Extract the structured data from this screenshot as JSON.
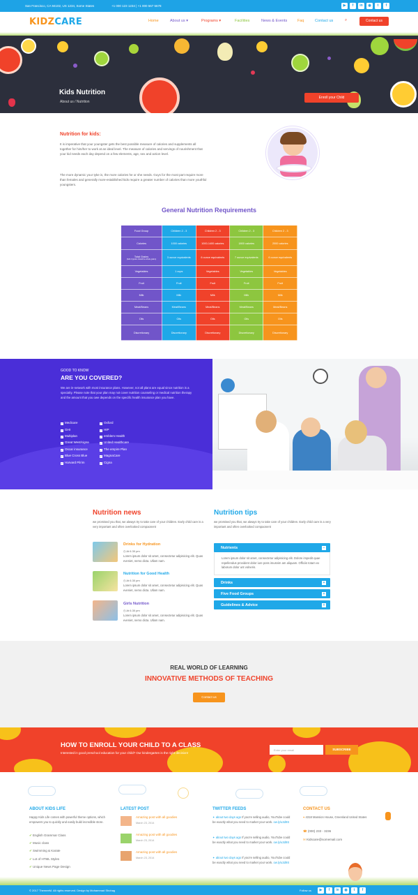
{
  "topbar": {
    "address": "San Francisco, CA 94102, US 1234, Some States",
    "phones": "+1 000 123 1234 | +1 000 567 5678",
    "social": [
      "▶",
      "f",
      "in",
      "◉",
      "t",
      "f"
    ]
  },
  "brand": {
    "logo_part1": "KIDZ",
    "logo_part2": "CARE",
    "colors": {
      "accent_blue": "#1ea3e6",
      "accent_red": "#f0422a",
      "purple": "#7155c9",
      "green": "#8dc63f",
      "orange": "#f7941d"
    }
  },
  "nav": {
    "items": [
      "Home",
      "About us",
      "Programs",
      "Facilities",
      "News & Events",
      "Faq",
      "Contact us"
    ],
    "contact_button": "Contact us",
    "search_icon": "search-icon"
  },
  "hero": {
    "title": "Kids Nutrition",
    "breadcrumb": "About us / Nutrition",
    "enroll_button": "Enroll your Child"
  },
  "about": {
    "heading": "Nutrition for kids:",
    "para1": "It is imperative that your youngster gets the best possible measure of calories and supplements all together for him/her to work at an ideal level. The measure of calories and servings of nourishment that your kid needs each day depend on a few elements, age, sex and action level.",
    "para2": "The more dynamic your tyke is, the more calories he or she needs. Guys for the most part require more than females and generally more-established kids require a greater number of calories than more youthful youngsters."
  },
  "table": {
    "title": "General Nutrition Requirements",
    "header": [
      "Food Group",
      "Children 2 - 3",
      "Children 2 - 3",
      "Children 2 - 3",
      "Children 2 - 3"
    ],
    "rows": [
      [
        "Calories",
        "1000 calories",
        "1000-1400 calories",
        "1800 calories",
        "2000 calories"
      ],
      [
        "Total Grains",
        "3 ounce equivalents",
        "6 ounce equivalents",
        "7 ounce equivalents",
        "6 ounce equivalents"
      ],
      [
        "Vegetables",
        "1 cups",
        "Vegetables",
        "Vegetables",
        "Vegetables"
      ],
      [
        "Fruit",
        "Fruit",
        "Fruit",
        "Fruit",
        "Fruit"
      ],
      [
        "Milk",
        "Milk",
        "Milk",
        "Milk",
        "Milk"
      ],
      [
        "Meat/Beans",
        "Meat/Beans",
        "Meat/Beans",
        "Meat/Beans",
        "Meat/Beans"
      ],
      [
        "Oils",
        "Oils",
        "Oils",
        "Oils",
        "Oils"
      ],
      [
        "Discretionary",
        "Discretionary",
        "Discretionary",
        "Discretionary",
        "Discretionary"
      ]
    ],
    "grains_note": "(half of grains should be whole grains)"
  },
  "covered": {
    "kicker": "GOOD TO KNOW",
    "heading": "ARE YOU COVERED?",
    "text": "We are in-network with most insurance plans. However, not all plans are equal since nutrition is a specialty. Please note that your plan may not cover nutrition counseling or medical nutrition therapy and the amount that you owe depends on the specific health insurance plan you have.",
    "col1": [
      "Medicare",
      "GHI",
      "Multiplan",
      "Great West/cigna",
      "Oscar insurance",
      "Blue Cross Blue",
      "Harvard Pilrim"
    ],
    "col2": [
      "Oxford",
      "HIP",
      "emblem Health",
      "United Healthcare",
      "The empire Plan",
      "MagnaCare",
      "Cigna"
    ]
  },
  "news": {
    "title": "Nutrition news",
    "intro": "we promised you that, we always try to take care of your children. Early child care is a very important and often overlooked compaonent",
    "items": [
      {
        "title": "Drinks for Hydration",
        "time": "At 6.30 pm",
        "text": "Lorem ipsum dolor sit amet, consectetur adipisicing elit. Quas eveniet, nemo dicta. Ullam nam."
      },
      {
        "title": "Nutrition for Good Health",
        "time": "At 6.30 pm",
        "text": "Lorem ipsum dolor sit amet, consectetur adipisicing elit. Quas eveniet, nemo dicta. Ullam nam."
      },
      {
        "title": "Girls Nutrition",
        "time": "At 6.30 pm",
        "text": "Lorem ipsum dolor sit amet, consectetur adipisicing elit. Quas eveniet, nemo dicta. Ullam nam."
      }
    ]
  },
  "tips": {
    "title": "Nutrition tips",
    "intro": "we promised you that, we always try to take care of your children. Early child care is a very important and often overlooked compaonent",
    "accordion": [
      {
        "label": "Nutrients",
        "body": "Lorem ipsum dolor sit amet, consectetur adipisicing elit. Dolore impedit quae repellendus provident dolor iure poss imusnim am aliquam. Officiis totam ex laborum dolor unt volneris.",
        "open": true
      },
      {
        "label": "Drinks"
      },
      {
        "label": "Five Food Groups"
      },
      {
        "label": "Guidelines & Advice"
      }
    ]
  },
  "learning": {
    "kicker": "REAL WORLD OF LEARNING",
    "heading": "INNOVATIVE METHODS OF TEACHING",
    "button": "Contact us"
  },
  "enroll": {
    "heading": "HOW TO ENROLL YOUR CHILD TO A CLASS",
    "sub": "Interested in good preschool education for your child? Our kindergarten is the right decision!",
    "placeholder": "Enter your email",
    "button": "SUBSCRIBE"
  },
  "footer": {
    "about": {
      "title": "ABOUT KIDS LIFE",
      "text": "Happy Kids Life comes with powerful theme options, which empowers you to quickly and easily build incredible store.",
      "list": [
        "English Grammar Class",
        "Music class",
        "Swimming & Karate",
        "Lot of HTML Styles",
        "Unique News Page Design"
      ]
    },
    "posts": {
      "title": "LATEST POST",
      "items": [
        {
          "title": "Amazing post with all goodies",
          "date": "March 23, 2014"
        },
        {
          "title": "Amazing post with all goodies",
          "date": "March 23, 2014"
        },
        {
          "title": "Amazing post with all goodies",
          "date": "March 23, 2014"
        }
      ]
    },
    "twitter": {
      "title": "TWITTER FEEDS",
      "items": [
        {
          "time": "about two days ago",
          "text": "If you're selling audio, YouTube could be exactly what you need to market your work.",
          "link": "ow.ly/u3d9S"
        },
        {
          "time": "about two days ago",
          "text": "If you're selling audio, YouTube could be exactly what you need to market your work.",
          "link": "ow.ly/u3d9S"
        },
        {
          "time": "about two days ago",
          "text": "If you're selling audio, YouTube could be exactly what you need to market your work.",
          "link": "ow.ly/u3d9S"
        }
      ]
    },
    "contact": {
      "title": "CONTACT US",
      "address": "4318 Mansion House, Greenland United States",
      "phone": "(000) 233 - 3236",
      "email": "Kidscare@somemail.com"
    },
    "copyright": "© 2017 ThemeeM. All rights reserved. Design by Mohammad Shohag",
    "follow": "Follow us"
  }
}
